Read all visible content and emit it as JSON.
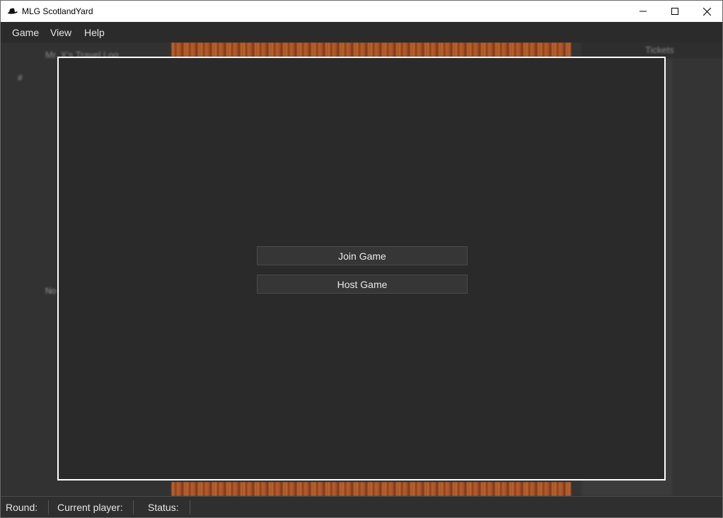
{
  "window": {
    "title": "MLG ScotlandYard",
    "icon": "detective-hat-icon"
  },
  "menu": {
    "items": [
      {
        "label": "Game"
      },
      {
        "label": "View"
      },
      {
        "label": "Help"
      }
    ]
  },
  "left_panel": {
    "title": "Mr. X's Travel Log",
    "column_hash": "#",
    "no_label": "No"
  },
  "right_panel": {
    "title": "Tickets"
  },
  "dialog": {
    "join_label": "Join Game",
    "host_label": "Host Game"
  },
  "statusbar": {
    "round_label": "Round:",
    "current_player_label": "Current player:",
    "status_label": "Status:"
  },
  "colors": {
    "background": "#2a2a2a",
    "dialog_border": "#ffffff",
    "wood": "#b55f2d"
  }
}
